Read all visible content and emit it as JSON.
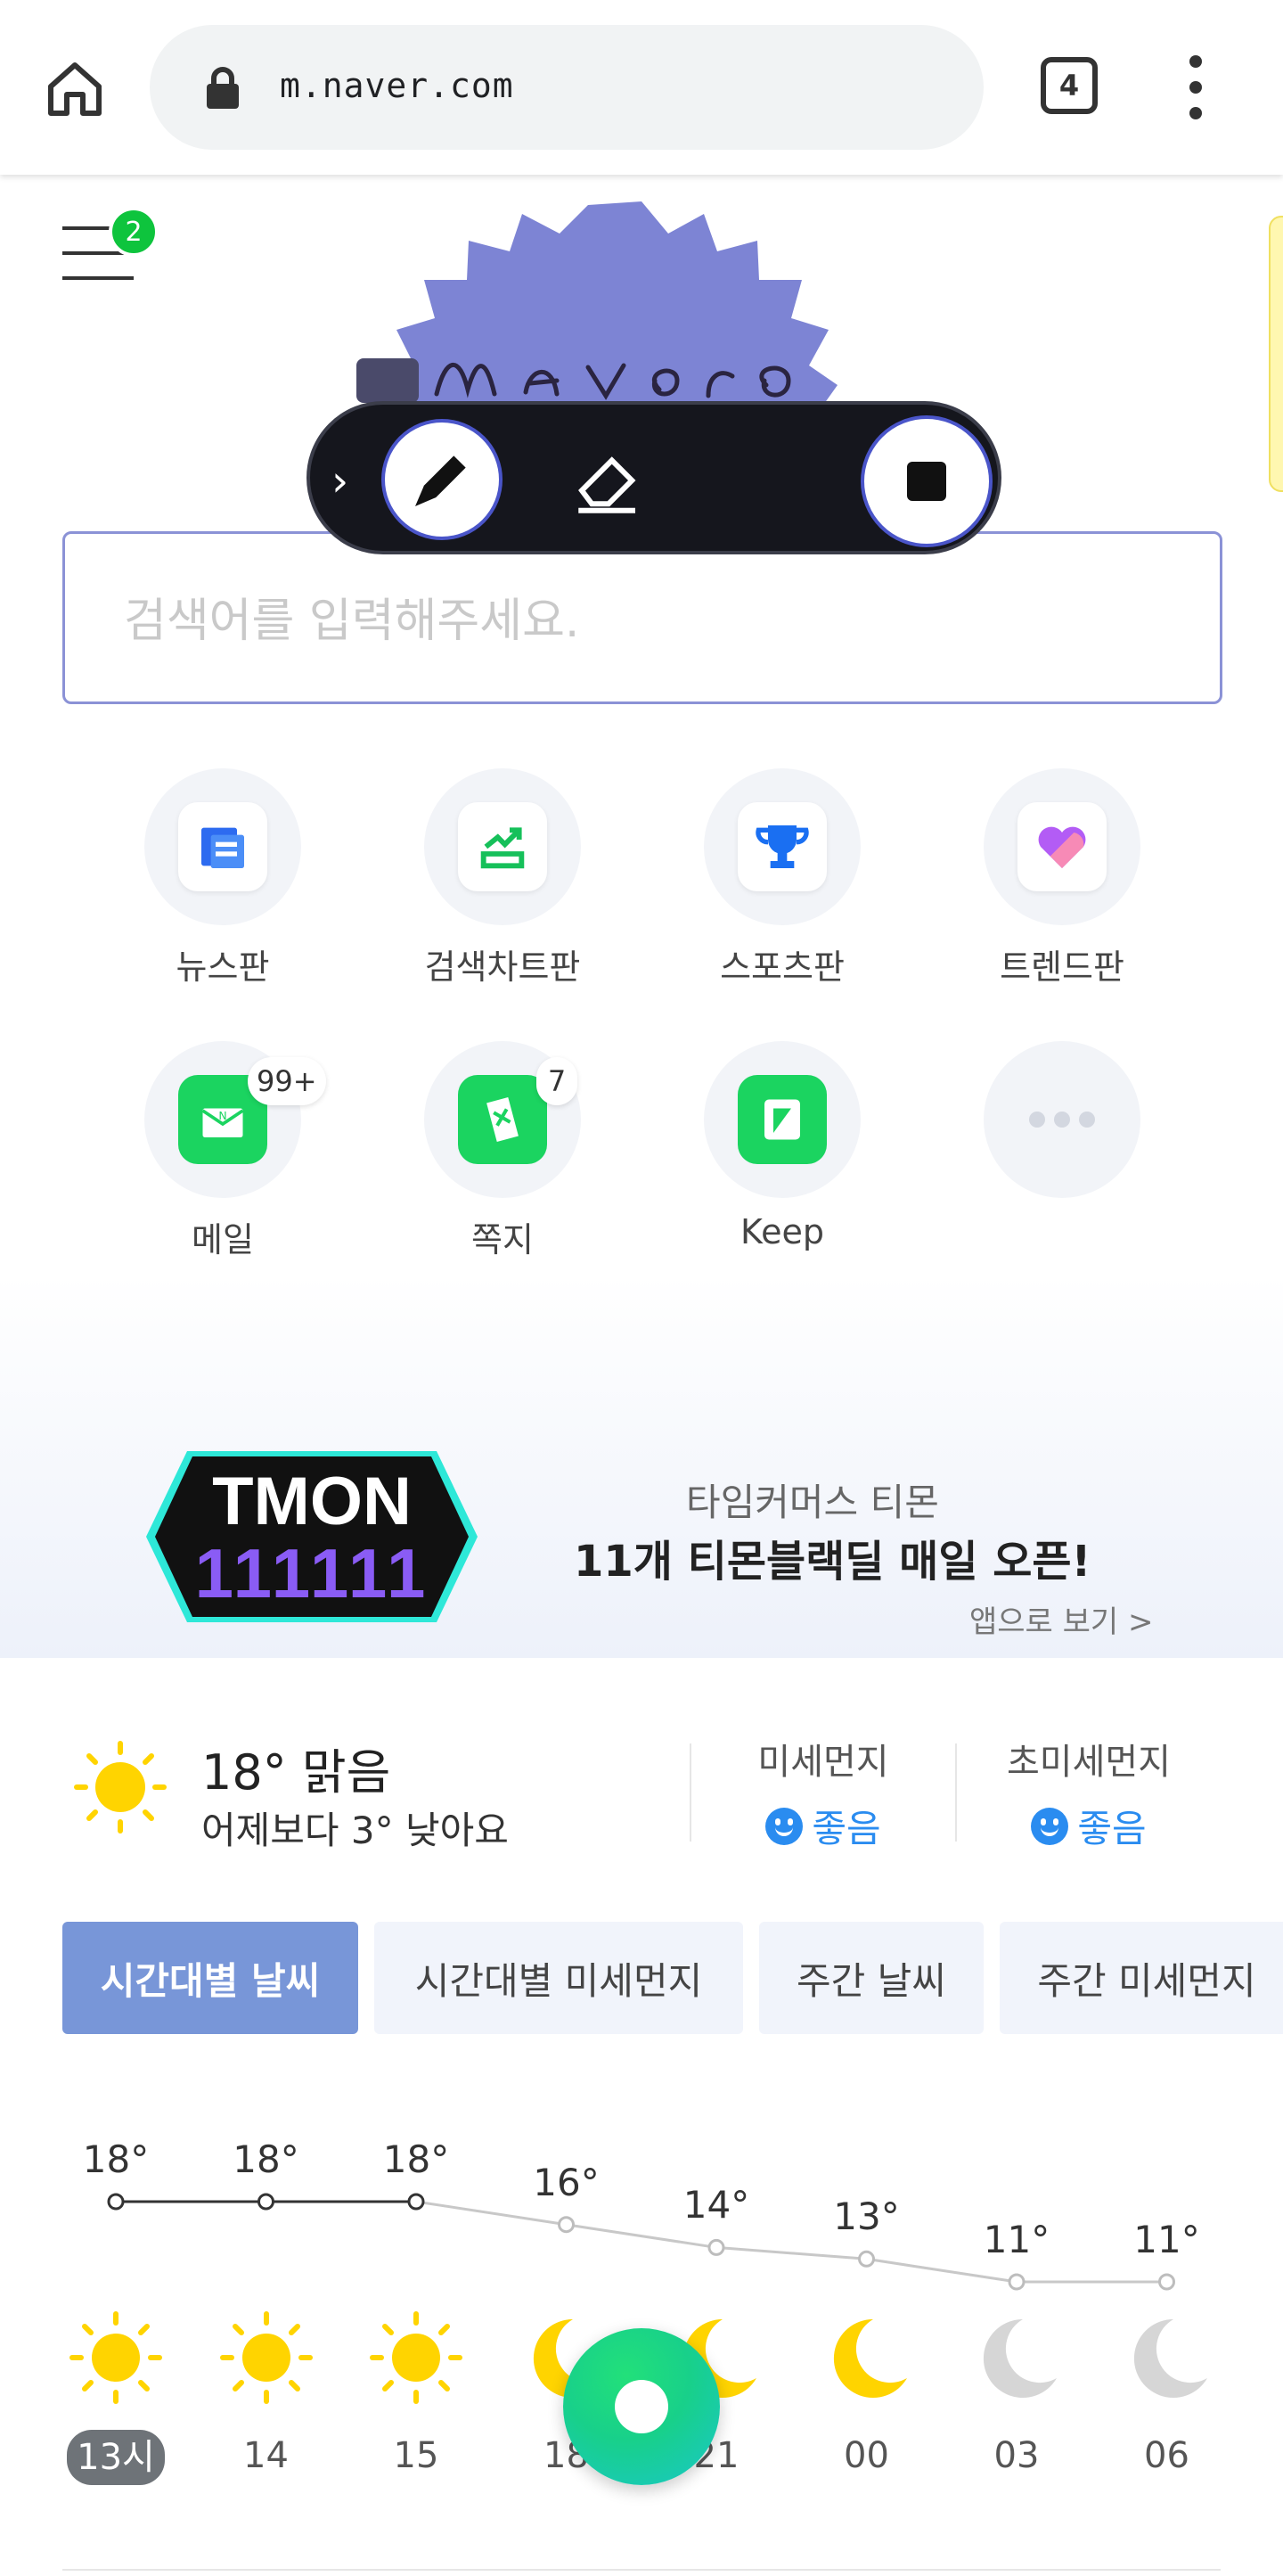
{
  "browser": {
    "url": "m.naver.com",
    "tab_count": "4"
  },
  "header": {
    "menu_badge": "2"
  },
  "search": {
    "placeholder": "검색어를 입력해주세요."
  },
  "shortcuts": [
    {
      "label": "뉴스판",
      "icon": "news-icon",
      "badge": ""
    },
    {
      "label": "검색차트판",
      "icon": "search-chart-icon",
      "badge": ""
    },
    {
      "label": "스포츠판",
      "icon": "trophy-icon",
      "badge": ""
    },
    {
      "label": "트렌드판",
      "icon": "heart-icon",
      "badge": ""
    },
    {
      "label": "메일",
      "icon": "mail-icon",
      "badge": "99+"
    },
    {
      "label": "쪽지",
      "icon": "note-icon",
      "badge": "7"
    },
    {
      "label": "Keep",
      "icon": "keep-icon",
      "badge": ""
    },
    {
      "label": "",
      "icon": "more-dots-icon",
      "badge": ""
    }
  ],
  "banner": {
    "logo_text": "TMON",
    "logo_number": "111111",
    "subtitle": "타임커머스 티몬",
    "title": "11개 티몬블랙딜 매일 오픈!",
    "link": "앱으로 보기 >"
  },
  "weather": {
    "current_temp": "18°",
    "condition": "맑음",
    "compare": "어제보다 3° 낮아요",
    "fine_dust_title": "미세먼지",
    "fine_dust_value": "좋음",
    "ultrafine_dust_title": "초미세먼지",
    "ultrafine_dust_value": "좋음",
    "tabs": [
      "시간대별 날씨",
      "시간대별 미세먼지",
      "주간 날씨",
      "주간 미세먼지"
    ],
    "active_tab": 0,
    "hourly": [
      {
        "hour": "13시",
        "temp": "18°",
        "icon": "sun-icon"
      },
      {
        "hour": "14",
        "temp": "18°",
        "icon": "sun-icon"
      },
      {
        "hour": "15",
        "temp": "18°",
        "icon": "sun-icon"
      },
      {
        "hour": "18",
        "temp": "16°",
        "icon": "moon-icon"
      },
      {
        "hour": "21",
        "temp": "14°",
        "icon": "moon-icon"
      },
      {
        "hour": "00",
        "temp": "13°",
        "icon": "moon-icon"
      },
      {
        "hour": "03",
        "temp": "11°",
        "icon": "cloudy-moon-icon"
      },
      {
        "hour": "06",
        "temp": "11°",
        "icon": "cloudy-moon-icon"
      }
    ]
  },
  "colors": {
    "accent_green": "#0ec43d",
    "tab_active": "#7896d8",
    "dust_blue": "#2a8cf0",
    "logo_purple": "#7d84d4"
  }
}
